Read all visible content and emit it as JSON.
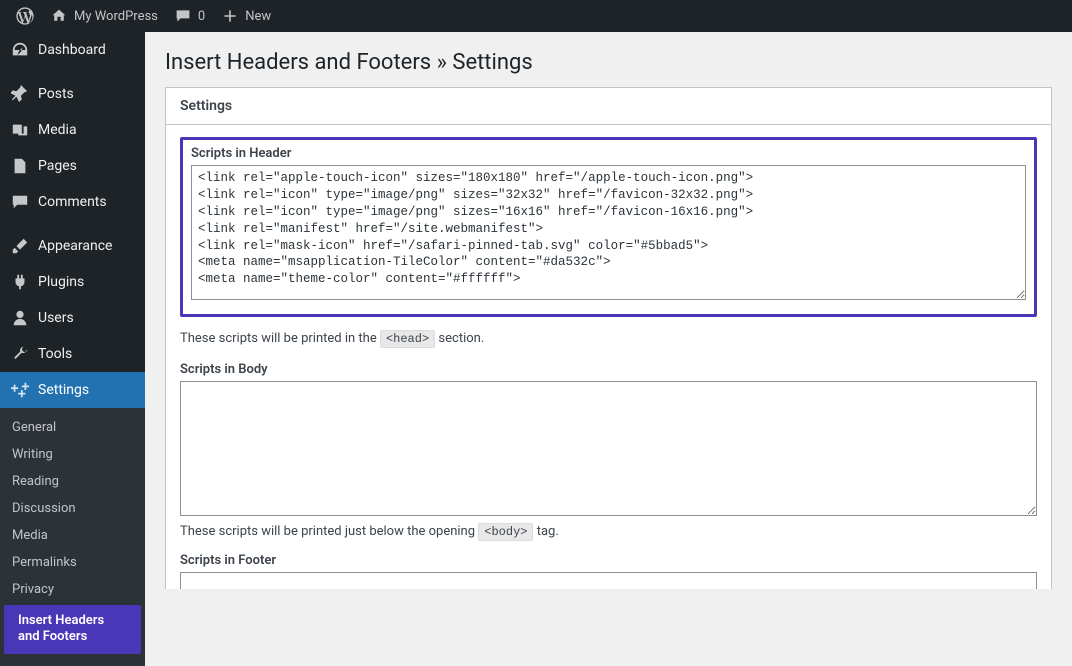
{
  "topbar": {
    "site_name": "My WordPress",
    "comments_count": "0",
    "new_label": "New"
  },
  "sidebar": {
    "main": [
      {
        "key": "dashboard",
        "label": "Dashboard",
        "icon": "dashboard-icon"
      },
      {
        "key": "posts",
        "label": "Posts",
        "icon": "pin-icon"
      },
      {
        "key": "media",
        "label": "Media",
        "icon": "media-icon"
      },
      {
        "key": "pages",
        "label": "Pages",
        "icon": "pages-icon"
      },
      {
        "key": "comments",
        "label": "Comments",
        "icon": "comment-icon"
      },
      {
        "key": "appearance",
        "label": "Appearance",
        "icon": "brush-icon"
      },
      {
        "key": "plugins",
        "label": "Plugins",
        "icon": "plug-icon"
      },
      {
        "key": "users",
        "label": "Users",
        "icon": "user-icon"
      },
      {
        "key": "tools",
        "label": "Tools",
        "icon": "wrench-icon"
      },
      {
        "key": "settings",
        "label": "Settings",
        "icon": "sliders-icon",
        "active": true
      }
    ],
    "settings_sub": [
      {
        "label": "General"
      },
      {
        "label": "Writing"
      },
      {
        "label": "Reading"
      },
      {
        "label": "Discussion"
      },
      {
        "label": "Media"
      },
      {
        "label": "Permalinks"
      },
      {
        "label": "Privacy"
      },
      {
        "label": "Insert Headers and Footers",
        "highlight": true
      }
    ]
  },
  "page": {
    "title": "Insert Headers and Footers » Settings",
    "panel_head": "Settings",
    "fields": {
      "header": {
        "label": "Scripts in Header",
        "value": "<link rel=\"apple-touch-icon\" sizes=\"180x180\" href=\"/apple-touch-icon.png\">\n<link rel=\"icon\" type=\"image/png\" sizes=\"32x32\" href=\"/favicon-32x32.png\">\n<link rel=\"icon\" type=\"image/png\" sizes=\"16x16\" href=\"/favicon-16x16.png\">\n<link rel=\"manifest\" href=\"/site.webmanifest\">\n<link rel=\"mask-icon\" href=\"/safari-pinned-tab.svg\" color=\"#5bbad5\">\n<meta name=\"msapplication-TileColor\" content=\"#da532c\">\n<meta name=\"theme-color\" content=\"#ffffff\">",
        "help_pre": "These scripts will be printed in the ",
        "help_tag": "<head>",
        "help_post": " section."
      },
      "body": {
        "label": "Scripts in Body",
        "value": "",
        "help_pre": "These scripts will be printed just below the opening ",
        "help_tag": "<body>",
        "help_post": " tag."
      },
      "footer": {
        "label": "Scripts in Footer",
        "value": ""
      }
    }
  }
}
